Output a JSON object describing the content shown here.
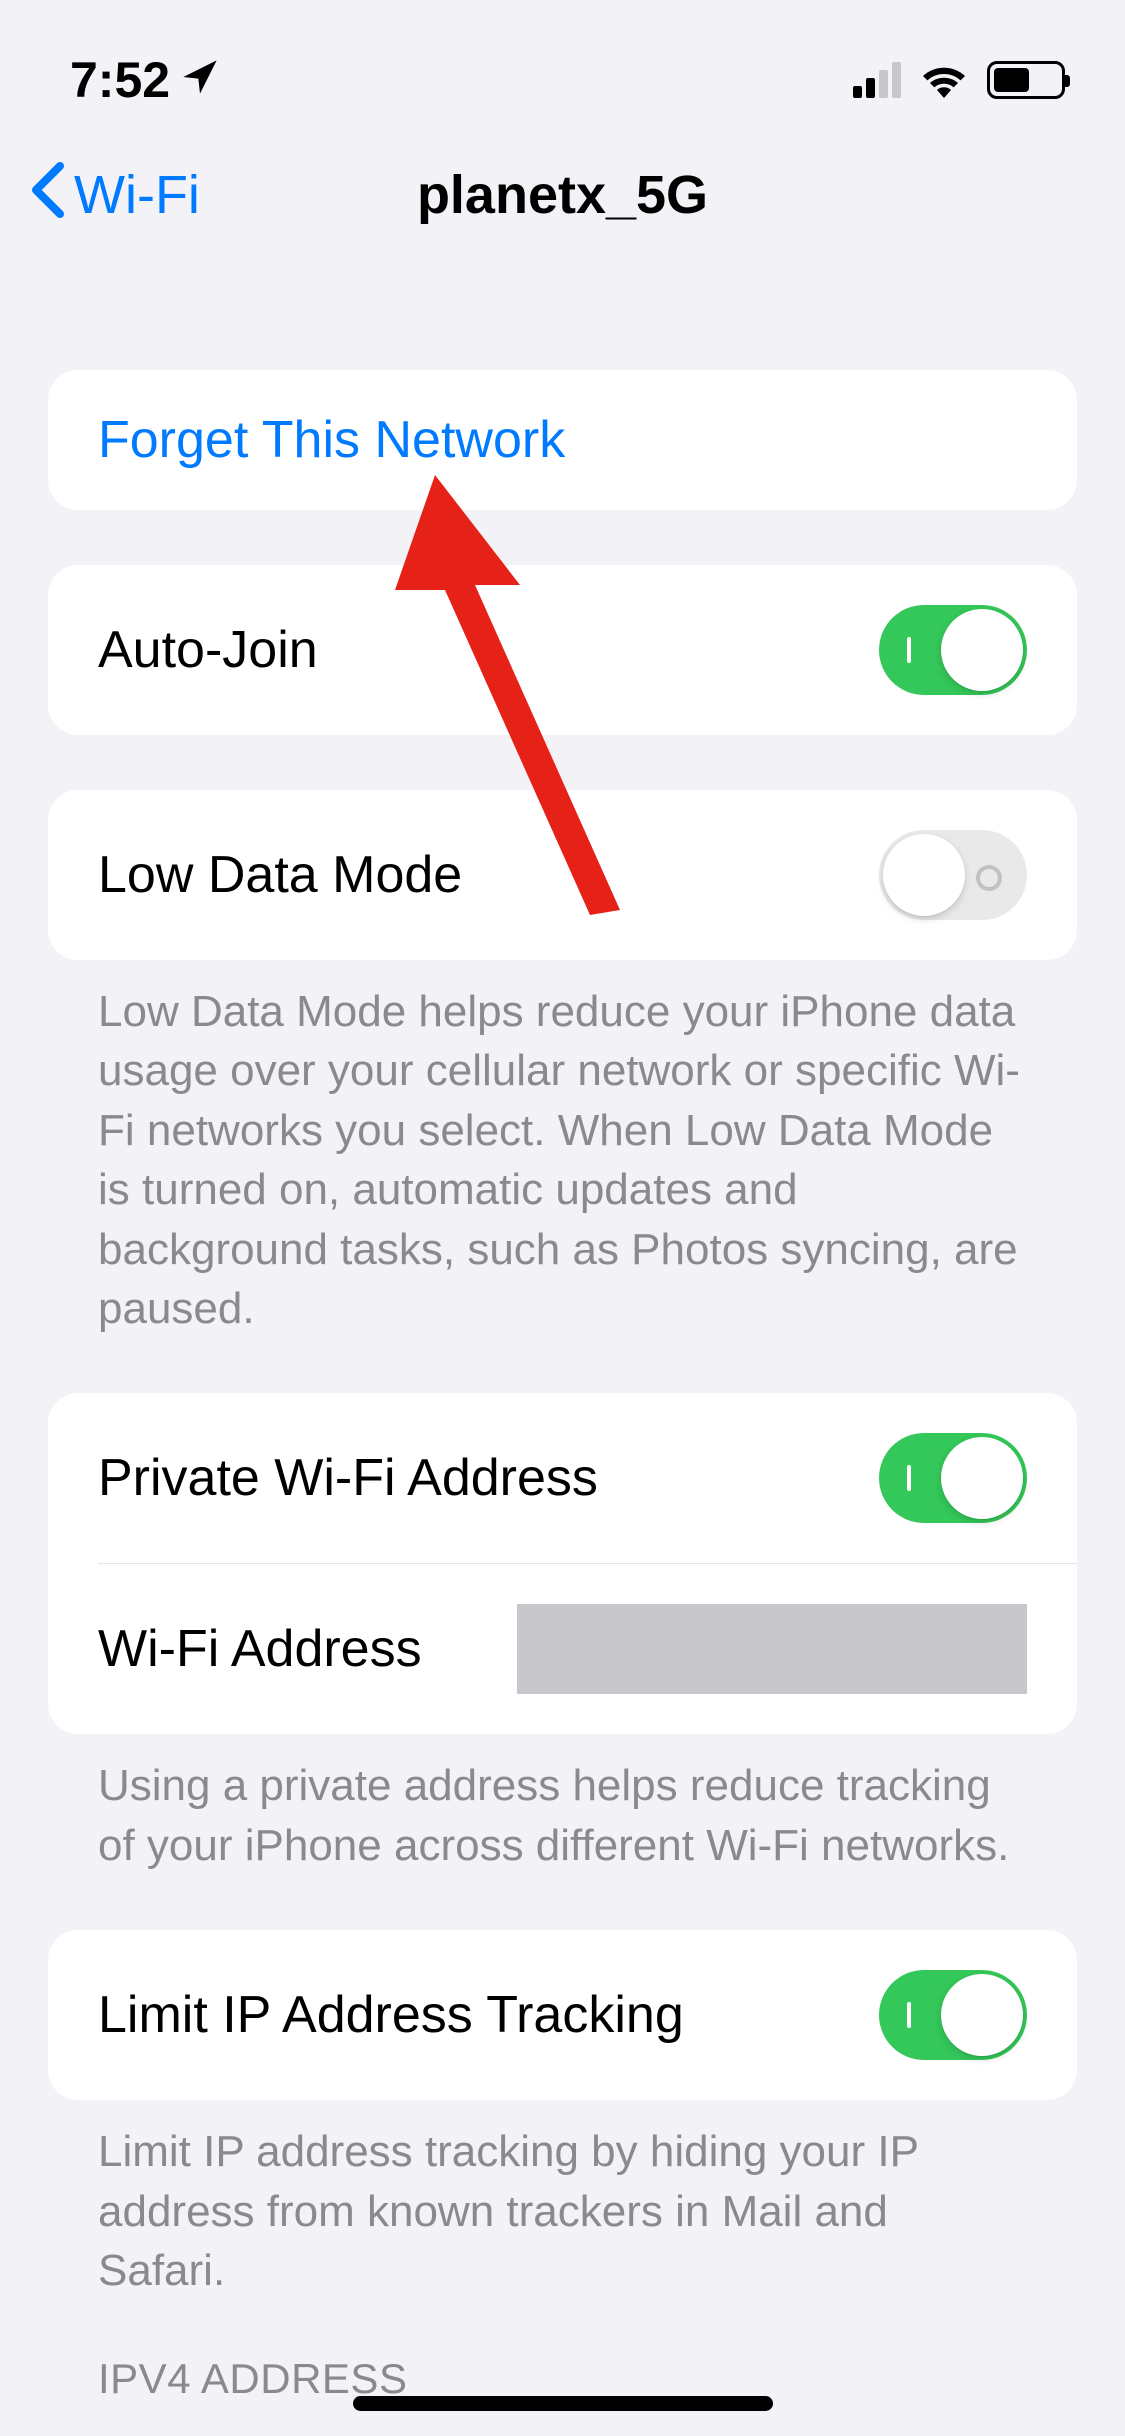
{
  "statusBar": {
    "time": "7:52"
  },
  "nav": {
    "backLabel": "Wi-Fi",
    "title": "planetx_5G"
  },
  "forget": {
    "label": "Forget This Network"
  },
  "autoJoin": {
    "label": "Auto-Join",
    "value": true
  },
  "lowDataMode": {
    "label": "Low Data Mode",
    "value": false,
    "footer": "Low Data Mode helps reduce your iPhone data usage over your cellular network or specific Wi-Fi networks you select. When Low Data Mode is turned on, automatic updates and background tasks, such as Photos syncing, are paused."
  },
  "privateAddress": {
    "label": "Private Wi-Fi Address",
    "value": true
  },
  "wifiAddress": {
    "label": "Wi-Fi Address"
  },
  "privateFooter": "Using a private address helps reduce tracking of your iPhone across different Wi-Fi networks.",
  "limitTracking": {
    "label": "Limit IP Address Tracking",
    "value": true,
    "footer": "Limit IP address tracking by hiding your IP address from known trackers in Mail and Safari."
  },
  "ipv4Header": "IPV4 ADDRESS"
}
